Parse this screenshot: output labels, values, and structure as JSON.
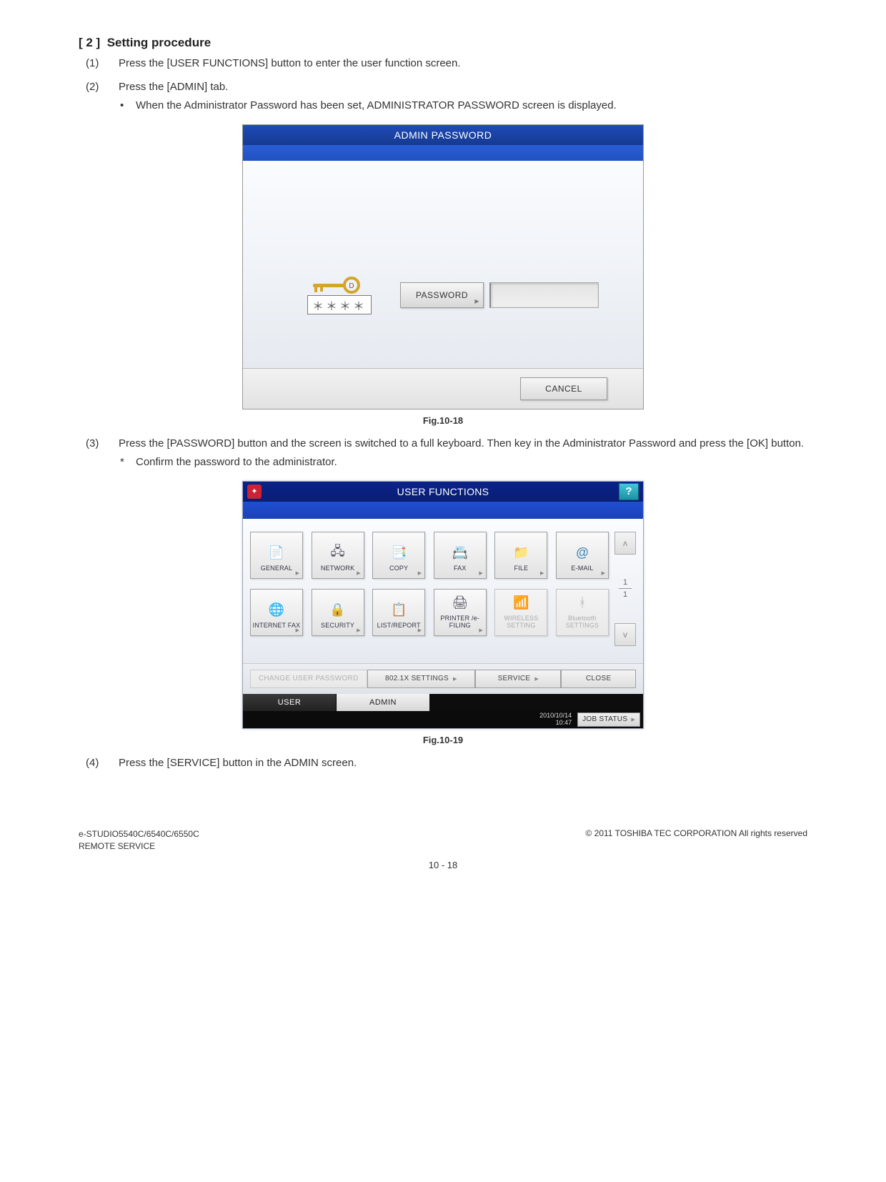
{
  "section": {
    "number": "[ 2 ]",
    "title": "Setting procedure"
  },
  "steps": {
    "s1": {
      "num": "(1)",
      "text": "Press the [USER FUNCTIONS] button to enter the user function screen."
    },
    "s2": {
      "num": "(2)",
      "text": "Press the [ADMIN] tab.",
      "sub_bullet": "•",
      "sub_text": "When the Administrator Password has been set, ADMINISTRATOR PASSWORD screen is displayed."
    },
    "s3": {
      "num": "(3)",
      "text": "Press the [PASSWORD] button and the screen is switched to a full keyboard. Then key in the Administrator Password and press the [OK] button.",
      "star": "*",
      "star_text": "Confirm the password to the administrator."
    },
    "s4": {
      "num": "(4)",
      "text": "Press the [SERVICE] button in the ADMIN screen."
    }
  },
  "fig1": {
    "caption": "Fig.10-18",
    "title": "ADMIN PASSWORD",
    "mask": "＊＊＊＊",
    "password_btn": "PASSWORD",
    "cancel_btn": "CANCEL"
  },
  "fig2": {
    "caption": "Fig.10-19",
    "title": "USER FUNCTIONS",
    "help": "?",
    "tiles_row1": [
      {
        "label": "GENERAL",
        "icon": "📄"
      },
      {
        "label": "NETWORK",
        "icon": "🖧"
      },
      {
        "label": "COPY",
        "icon": "📑"
      },
      {
        "label": "FAX",
        "icon": "📇"
      },
      {
        "label": "FILE",
        "icon": "📁"
      },
      {
        "label": "E-MAIL",
        "icon": "@"
      }
    ],
    "tiles_row2": [
      {
        "label": "INTERNET FAX",
        "icon": "🌐",
        "disabled": false
      },
      {
        "label": "SECURITY",
        "icon": "🔒",
        "disabled": false
      },
      {
        "label": "LIST/REPORT",
        "icon": "📋",
        "disabled": false
      },
      {
        "label": "PRINTER /e-FILING",
        "icon": "🖨",
        "disabled": false
      },
      {
        "label": "WIRELESS SETTING",
        "icon": "📶",
        "disabled": true
      },
      {
        "label": "Bluetooth SETTINGS",
        "icon": "ᚼ",
        "disabled": true
      }
    ],
    "scroll": {
      "page": "1",
      "of": "1"
    },
    "btns": {
      "change_pw": "CHANGE USER PASSWORD",
      "dot1x": "802.1X SETTINGS",
      "service": "SERVICE",
      "close": "CLOSE"
    },
    "tabs": {
      "user": "USER",
      "admin": "ADMIN"
    },
    "timestamp_line1": "2010/10/14",
    "timestamp_line2": "10:47",
    "job_status": "JOB STATUS"
  },
  "footer": {
    "left_line1": "e-STUDIO5540C/6540C/6550C",
    "left_line2": "REMOTE SERVICE",
    "right": "© 2011 TOSHIBA TEC CORPORATION All rights reserved",
    "page": "10 - 18"
  }
}
